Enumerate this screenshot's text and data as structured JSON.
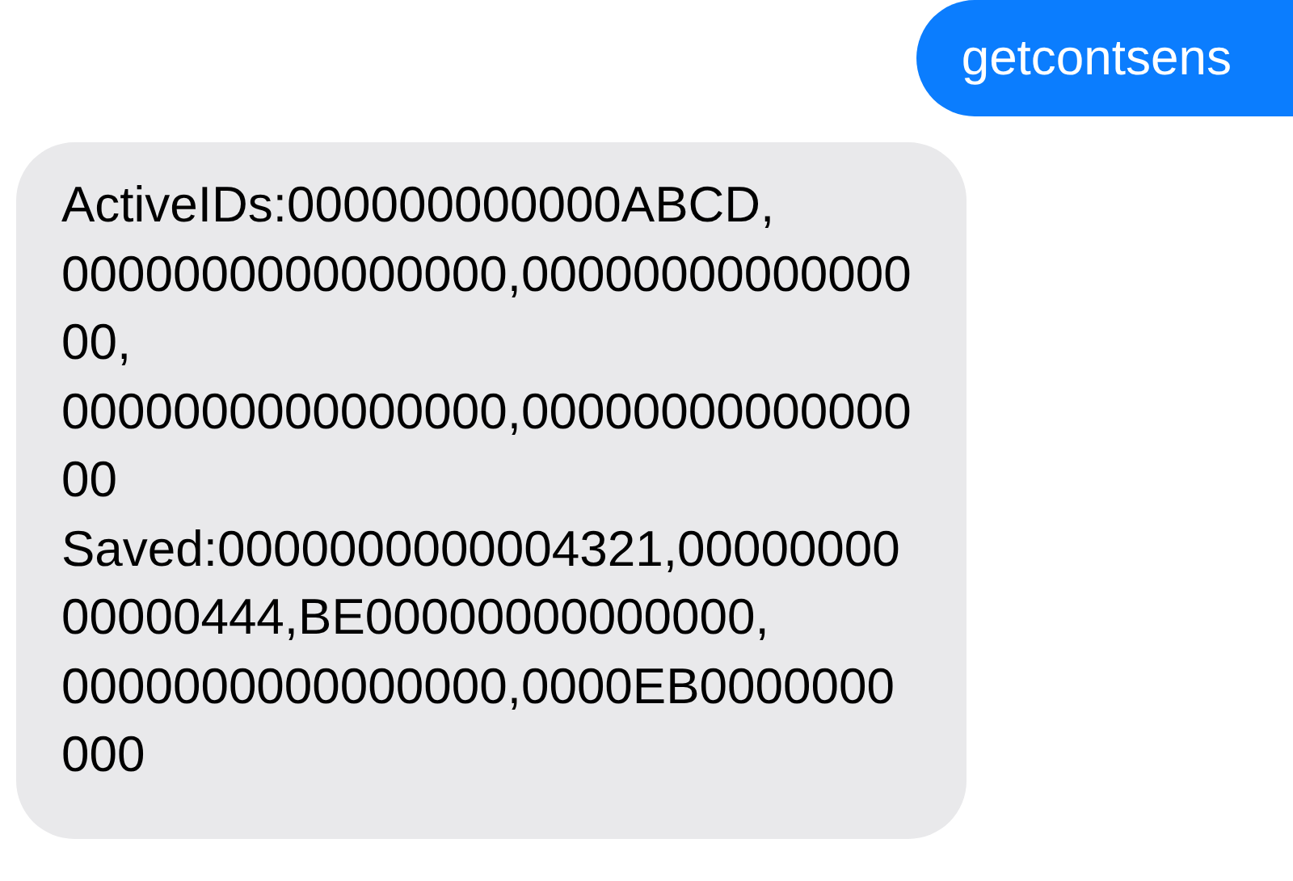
{
  "messages": [
    {
      "kind": "sent",
      "text": "getcontsens"
    },
    {
      "kind": "received",
      "text": "ActiveIDs:000000000000ABCD,\n0000000000000000,0000000000000000,\n0000000000000000,0000000000000000\nSaved:0000000000004321,0000000000000444,BE00000000000000,\n0000000000000000,0000EB0000000000"
    }
  ]
}
